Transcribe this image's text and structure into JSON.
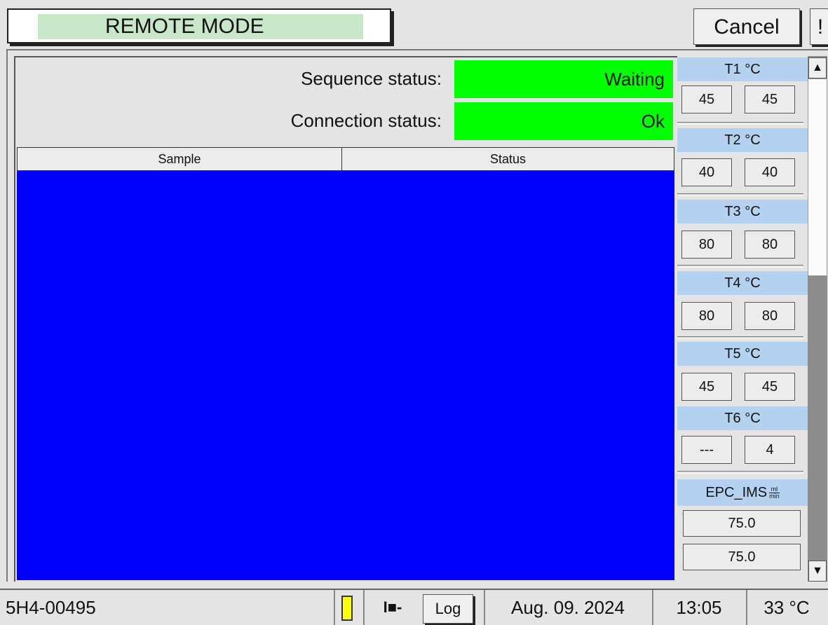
{
  "header": {
    "mode_label": "REMOTE MODE",
    "cancel_label": "Cancel",
    "alert_label": "!"
  },
  "status": {
    "sequence_label": "Sequence status:",
    "sequence_value": "Waiting",
    "connection_label": "Connection status:",
    "connection_value": "Ok",
    "ok_color": "#00ff00"
  },
  "table": {
    "columns": [
      "Sample",
      "Status"
    ],
    "rows": [],
    "body_color": "#0000ff"
  },
  "temperatures": [
    {
      "label": "T1 °C",
      "set": "45",
      "actual": "45"
    },
    {
      "label": "T2 °C",
      "set": "40",
      "actual": "40"
    },
    {
      "label": "T3 °C",
      "set": "80",
      "actual": "80"
    },
    {
      "label": "T4 °C",
      "set": "80",
      "actual": "80"
    },
    {
      "label": "T5 °C",
      "set": "45",
      "actual": "45"
    },
    {
      "label": "T6 °C",
      "set": "---",
      "actual": "4"
    }
  ],
  "epc": {
    "label": "EPC_IMS",
    "unit_top": "ml",
    "unit_bottom": "min",
    "set": "75.0",
    "actual": "75.0"
  },
  "footer": {
    "device_id": "5H4-00495",
    "battery_icon": "battery-icon",
    "plug_icon": "power-plug-icon",
    "plug_glyph": "I■-",
    "log_label": "Log",
    "date": "Aug. 09. 2024",
    "time": "13:05",
    "temperature": "33 °C"
  },
  "scrollbar": {
    "up_glyph": "▲",
    "down_glyph": "▼"
  }
}
